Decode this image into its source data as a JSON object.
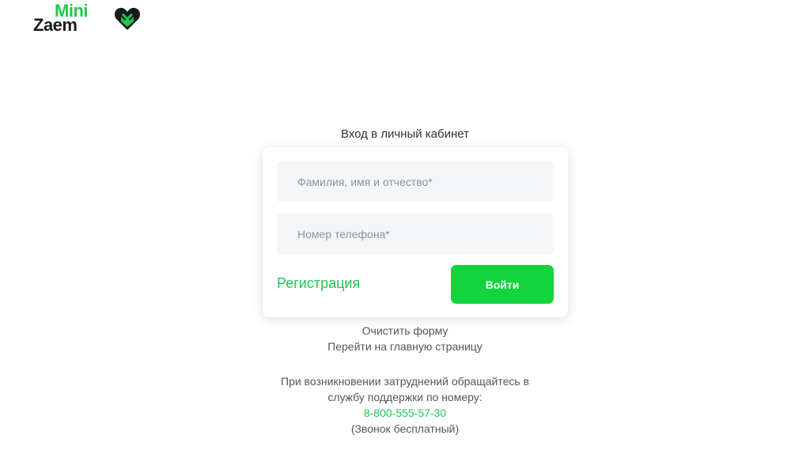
{
  "logo": {
    "top_text": "Mini",
    "bottom_text": "Zaem",
    "brand_green": "#1ec94c",
    "brand_dark": "#1a1a1a"
  },
  "login": {
    "title": "Вход в личный кабинет",
    "fio_placeholder": "Фамилия, имя и отчество*",
    "fio_value": "",
    "phone_placeholder": "Номер телефона*",
    "phone_value": "",
    "register_label": "Регистрация",
    "submit_label": "Войти"
  },
  "links": {
    "clear_form": "Очистить форму",
    "go_home": "Перейти на главную страницу"
  },
  "support": {
    "line1": "При возникновении затруднений обращайтесь в",
    "line2": "службу поддержки по номеру:",
    "phone": "8-800-555-57-30",
    "note": "(Звонок бесплатный)"
  },
  "colors": {
    "accent": "#1ec94c",
    "button": "#12d43c",
    "field_bg": "#f5f6f8"
  }
}
